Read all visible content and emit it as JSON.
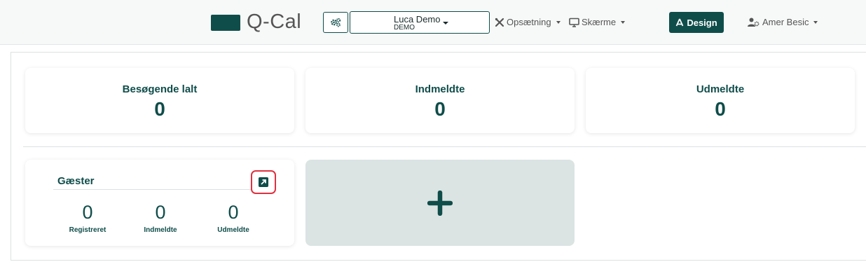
{
  "header": {
    "logo_text": "Q-Cal",
    "org": {
      "name": "Luca Demo",
      "sub": "DEMO"
    },
    "nav": [
      {
        "label": "Opsætning",
        "icon": "tools-icon"
      },
      {
        "label": "Skærme",
        "icon": "monitor-icon"
      }
    ],
    "design_label": "Design",
    "user_name": "Amer Besic"
  },
  "stats": [
    {
      "title": "Besøgende lalt",
      "value": "0"
    },
    {
      "title": "Indmeldte",
      "value": "0"
    },
    {
      "title": "Udmeldte",
      "value": "0"
    }
  ],
  "widget": {
    "title": "Gæster",
    "metrics": [
      {
        "value": "0",
        "label": "Registreret"
      },
      {
        "value": "0",
        "label": "Indmeldte"
      },
      {
        "value": "0",
        "label": "Udmeldte"
      }
    ]
  },
  "colors": {
    "primary": "#0f4d4a",
    "highlight": "#e03040",
    "add_card_bg": "#dbe3e3"
  }
}
